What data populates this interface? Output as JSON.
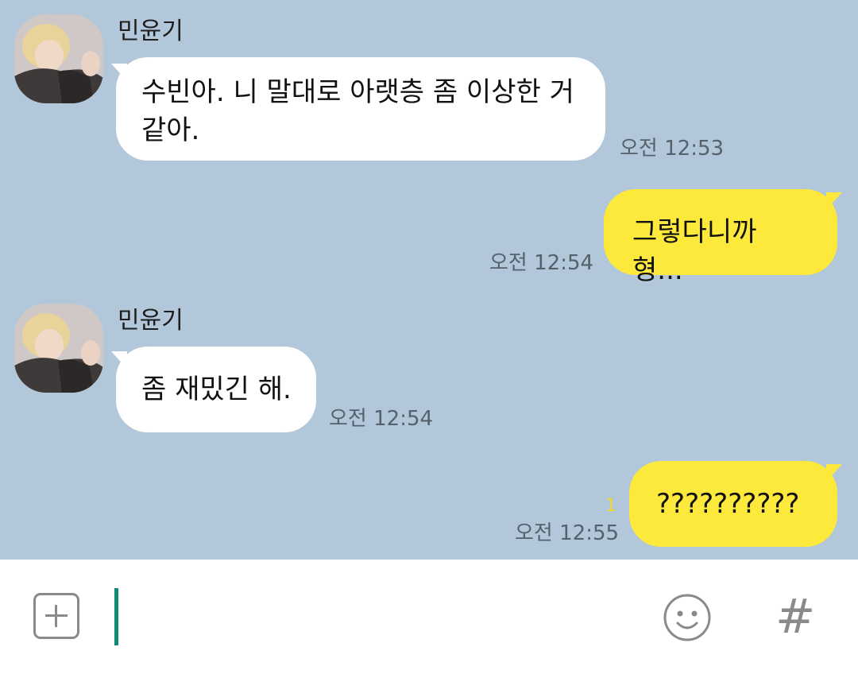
{
  "messages": [
    {
      "direction": "incoming",
      "sender": "민윤기",
      "lines": [
        "수빈아. 니 말대로 아랫층 좀 이상한 거",
        "같아."
      ],
      "time": "오전 12:53"
    },
    {
      "direction": "outgoing",
      "text": "그렇다니까 형...",
      "time": "오전 12:54"
    },
    {
      "direction": "incoming",
      "sender": "민윤기",
      "text": "좀 재밌긴 해.",
      "time": "오전 12:54"
    },
    {
      "direction": "outgoing",
      "text": "??????????",
      "unread_count": "1",
      "time": "오전 12:55"
    }
  ],
  "input_bar": {
    "add_icon": "plus-square-icon",
    "emoji_icon": "smiley-face-icon",
    "hash_label": "#"
  },
  "colors": {
    "chat_background": "#b2c7d9",
    "incoming_bubble": "#ffffff",
    "outgoing_bubble": "#fde93c",
    "caret": "#0f8b73",
    "unread_badge": "#f2d631"
  }
}
